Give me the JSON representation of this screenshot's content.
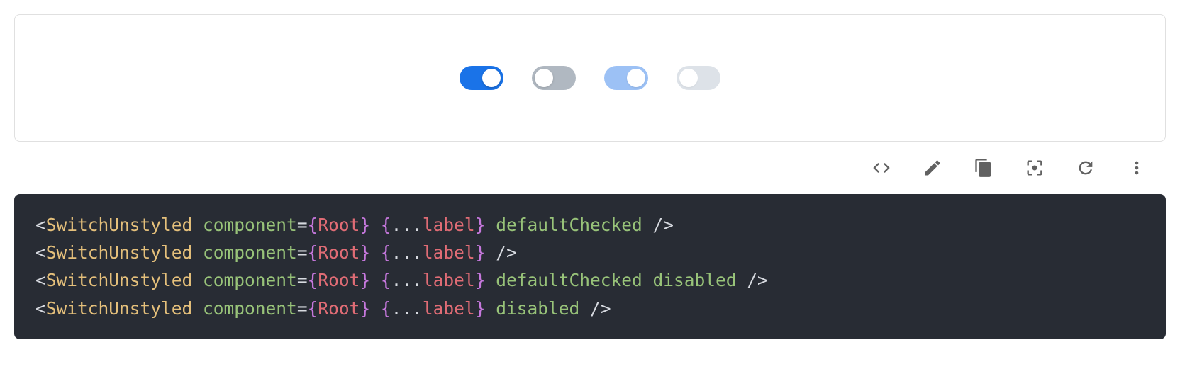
{
  "demo": {
    "switches": [
      {
        "state": "on",
        "disabled": false
      },
      {
        "state": "off",
        "disabled": false
      },
      {
        "state": "on",
        "disabled": true
      },
      {
        "state": "off",
        "disabled": true
      }
    ]
  },
  "toolbar": {
    "icons": [
      "code-icon",
      "edit-icon",
      "copy-icon",
      "fullscreen-icon",
      "refresh-icon",
      "more-vert-icon"
    ]
  },
  "code": {
    "lines": [
      {
        "tag": "SwitchUnstyled",
        "attr": "component",
        "expr": "Root",
        "spreadPrefix": "...",
        "spreadName": "label",
        "extras": [
          "defaultChecked"
        ]
      },
      {
        "tag": "SwitchUnstyled",
        "attr": "component",
        "expr": "Root",
        "spreadPrefix": "...",
        "spreadName": "label",
        "extras": []
      },
      {
        "tag": "SwitchUnstyled",
        "attr": "component",
        "expr": "Root",
        "spreadPrefix": "...",
        "spreadName": "label",
        "extras": [
          "defaultChecked",
          "disabled"
        ]
      },
      {
        "tag": "SwitchUnstyled",
        "attr": "component",
        "expr": "Root",
        "spreadPrefix": "...",
        "spreadName": "label",
        "extras": [
          "disabled"
        ]
      }
    ]
  },
  "colors": {
    "switch_on": "#1a73e8",
    "switch_off": "#b0b8c1",
    "switch_on_disabled": "#9cc1f5",
    "switch_off_disabled": "#dde2e8",
    "code_bg": "#282c34"
  }
}
